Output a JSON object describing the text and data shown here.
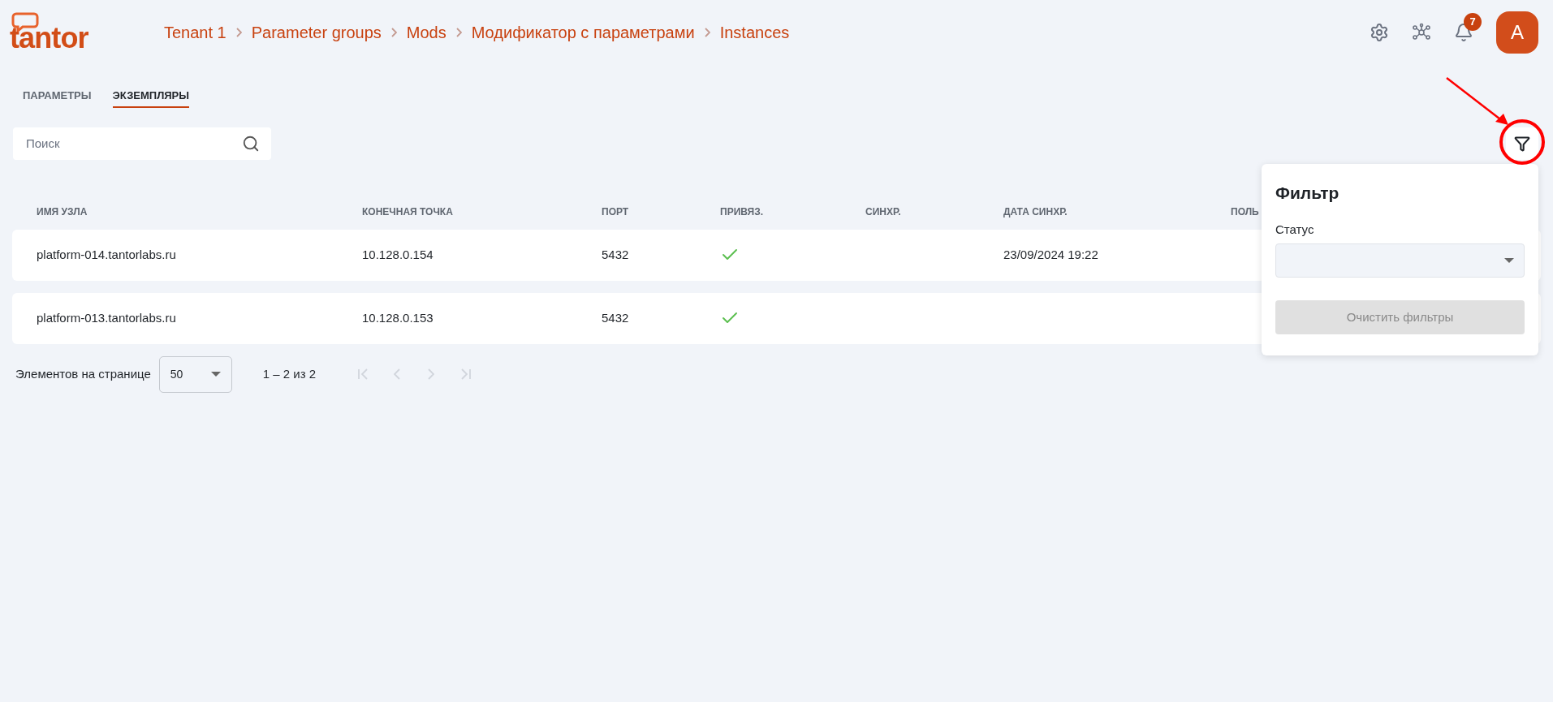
{
  "logo": "tantor",
  "breadcrumbs": [
    "Tenant 1",
    "Parameter groups",
    "Mods",
    "Модификатор с параметрами",
    "Instances"
  ],
  "header": {
    "notifications_badge": "7",
    "avatar": "A"
  },
  "tabs": [
    {
      "label": "ПАРАМЕТРЫ",
      "selected": false
    },
    {
      "label": "ЭКЗЕМПЛЯРЫ",
      "selected": true
    }
  ],
  "search": {
    "placeholder": "Поиск"
  },
  "table": {
    "columns": [
      "ИМЯ УЗЛА",
      "КОНЕЧНАЯ ТОЧКА",
      "ПОРТ",
      "ПРИВЯЗ.",
      "СИНХР.",
      "ДАТА СИНХР.",
      "ПОЛЬ"
    ],
    "rows": [
      {
        "node": "platform-014.tantorlabs.ru",
        "endpoint": "10.128.0.154",
        "port": "5432",
        "bound": true,
        "sync_date": "23/09/2024 19:22"
      },
      {
        "node": "platform-013.tantorlabs.ru",
        "endpoint": "10.128.0.153",
        "port": "5432",
        "bound": true
      }
    ]
  },
  "pagination": {
    "label": "Элементов на странице",
    "page_size": "50",
    "range": "1 – 2 из 2",
    "first_disabled": true,
    "prev_disabled": true,
    "next_disabled": true,
    "last_disabled": true
  },
  "filter_panel": {
    "title": "Фильтр",
    "status_label": "Статус",
    "clear_button": "Очистить фильтры",
    "clear_disabled": true
  }
}
